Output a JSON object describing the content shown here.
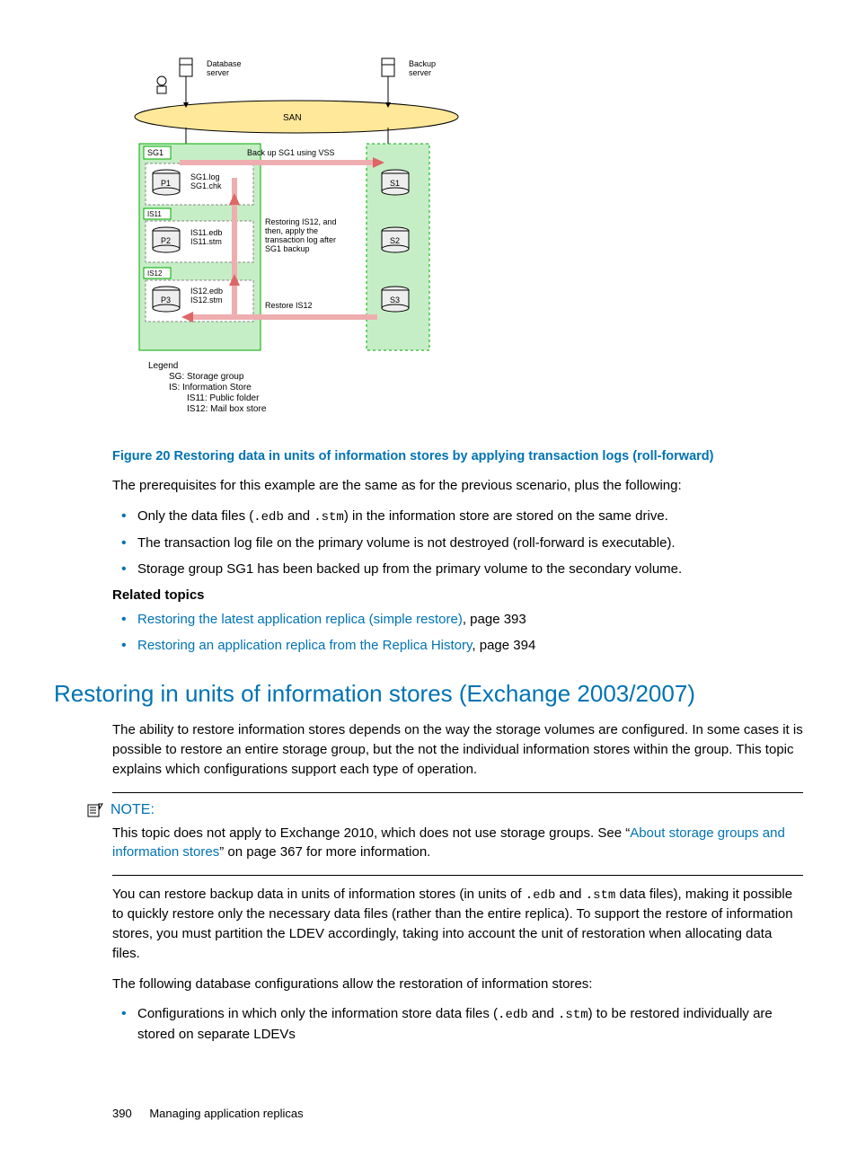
{
  "diagram": {
    "db_server": "Database\nserver",
    "bk_server": "Backup\nserver",
    "san": "SAN",
    "sg1": "SG1",
    "p1": "P1",
    "p2": "P2",
    "p3": "P3",
    "s1": "S1",
    "s2": "S2",
    "s3": "S3",
    "is11": "IS11",
    "is12": "IS12",
    "p1_files": "SG1.log\nSG1.chk",
    "p2_files": "IS11.edb\nIS11.stm",
    "p3_files": "IS12.edb\nIS12.stm",
    "backup_lbl": "Back up SG1 using VSS",
    "restore_lbl": "Restoring IS12, and\nthen, apply the\ntransaction log after\nSG1 backup",
    "restore_is12": "Restore IS12",
    "legend_title": "Legend",
    "legend_sg": "SG: Storage group",
    "legend_is": "IS: Information Store",
    "legend_is11": "IS11: Public folder",
    "legend_is12": "IS12: Mail box store"
  },
  "figure_caption": "Figure 20 Restoring data in units of information stores by applying transaction logs (roll-forward)",
  "prereq_intro": "The prerequisites for this example are the same as for the previous scenario, plus the following:",
  "bullets1": {
    "b1a": "Only the data files (",
    "b1b": " and ",
    "b1c": ") in the information store are stored on the same drive.",
    "b2": "The transaction log file on the primary volume is not destroyed (roll-forward is executable).",
    "b3": "Storage group SG1 has been backed up from the primary volume to the secondary volume."
  },
  "related_topics_title": "Related topics",
  "related": [
    {
      "link": "Restoring the latest application replica (simple restore)",
      "page": ", page 393"
    },
    {
      "link": "Restoring an application replica from the Replica History",
      "page": ", page 394"
    }
  ],
  "section_heading": "Restoring in units of information stores (Exchange 2003/2007)",
  "section_p1": "The ability to restore information stores depends on the way the storage volumes are configured. In some cases it is possible to restore an entire storage group, but the not the individual information stores within the group. This topic explains which configurations support each type of operation.",
  "note_label": "NOTE:",
  "note_body_a": "This topic does not apply to Exchange 2010, which does not use storage groups. See “",
  "note_link": "About storage groups and information stores",
  "note_body_b": "” on page 367 for more information.",
  "section_p2a": "You can restore backup data in units of information stores (in units of ",
  "section_p2b": " and ",
  "section_p2c": " data files), making it possible to quickly restore only the necessary data files (rather than the entire replica). To support the restore of information stores, you must partition the LDEV accordingly, taking into account the unit of restoration when allocating data files.",
  "section_p3": "The following database configurations allow the restoration of information stores:",
  "bullets2": {
    "b1a": "Configurations in which only the information store data files (",
    "b1b": " and ",
    "b1c": ") to be restored individually are stored on separate LDEVs"
  },
  "footer_page": "390",
  "footer_title": "Managing application replicas",
  "mono": {
    "edb": ".edb",
    "stm": ".stm"
  }
}
